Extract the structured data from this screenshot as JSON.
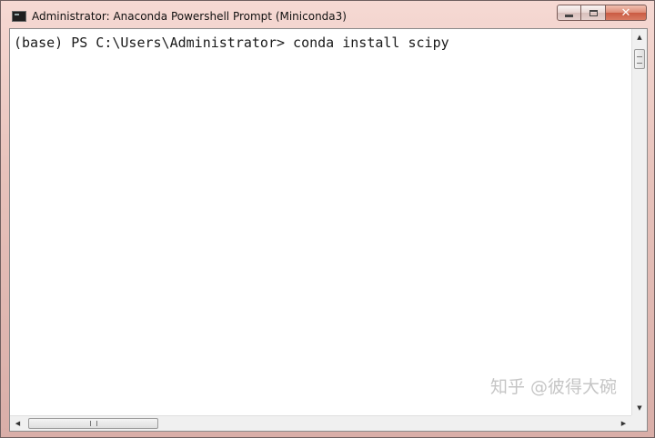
{
  "window": {
    "title": "Administrator: Anaconda Powershell Prompt (Miniconda3)",
    "app_icon": "console-icon"
  },
  "caption_buttons": {
    "minimize_icon": "minimize-icon",
    "maximize_icon": "maximize-icon",
    "close_label": "✕"
  },
  "console": {
    "lines": [
      "(base) PS C:\\Users\\Administrator> conda install scipy"
    ]
  },
  "scrollbars": {
    "up_arrow": "▲",
    "down_arrow": "▼",
    "left_arrow": "◀",
    "right_arrow": "▶"
  },
  "watermark": {
    "text": "知乎 @彼得大碗"
  }
}
